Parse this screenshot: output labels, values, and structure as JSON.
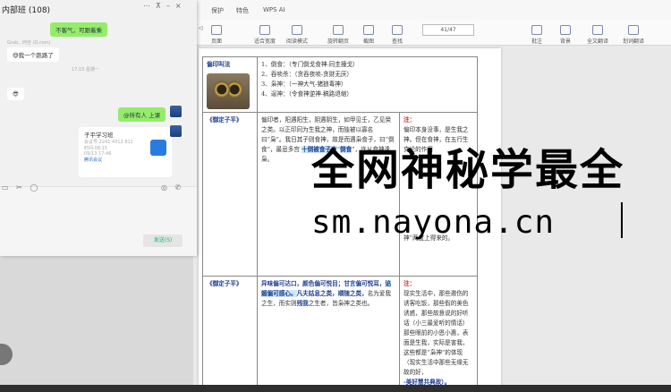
{
  "chat": {
    "title": "内部班 (108)",
    "bubbles": {
      "me1": "不客气，可跟着乘",
      "other1": "我一个跑路了",
      "other_sender": "Grab...何佳 (Q.com)",
      "me2": "@所有人  上课"
    },
    "time1": "17:15 星期一",
    "card": {
      "title": "子平学习班",
      "line1": "会议号:2241 4312 811",
      "line2": "时间:08:15",
      "line3": "09/13 17:46",
      "source": "腾讯会议"
    },
    "send_label": "发送(S)",
    "colors": {
      "me_bubble": "#95ec69"
    }
  },
  "doc": {
    "menu": [
      "保护",
      "特色",
      "WPS AI"
    ],
    "page_indicator": "41/47",
    "toolbar_items": [
      "◁",
      "页面",
      "适合宽度",
      "阅读模式",
      "旋转翻页",
      "截图",
      "查找",
      "批注",
      "背景",
      "全文翻译",
      "划词翻译"
    ],
    "table": {
      "row1": {
        "label": "偏印叫法",
        "items": [
          "1、倒食：（专门倒戈食神-同圭撞戈）",
          "2、吞啖杀：（贪吞夜啖-贪财无厌）",
          "3、枭神：（一神大气-猪狼毒神）",
          "4、逞神：（令食神逆神-稿路退缩）"
        ]
      },
      "row2": {
        "label": "《御定子平》",
        "body": "偏印者，阳遇阳生，阴遇阴生，如甲见壬，乙见癸之类。以正印同为生我之神，而独被以寡名曰“枭”。我日其子则食神，故是而遇枭食子，曰“倒食”，最忌多宫",
        "hl1": "十倒被食子之",
        "hl2": "倒食",
        "tail": "”，许从食神逢枭。",
        "note_label": "注：",
        "note": "偏印本身没事，是生我之神。但在食神，在五行生克论的作用",
        "note_tail": "神”两度上得来的。"
      },
      "row3": {
        "label": "《御定子平》",
        "body1": "异味偏可达口，",
        "body2": "颜色偏可悦目；",
        "body3": "甘言偏可悦耳，",
        "body4": "谄媚偏可感心。",
        "body5": "凡夫姑息之类，",
        "body6": "顺随之类，",
        "body7": "名为爱我之生，而实则",
        "body8": "残我",
        "body9": "之生者，皆枭神之类也。",
        "note_label": "注：",
        "note": "现实生活中，那些邀伤的诱客吃饭，那些假的美色诱惑，那些故意说的好听话（小三最爱听的情话）那些眼前的小恩小惠，表面是生我，实际是害我，这些都是“枭神”的体现（现实生活中那些无缘无故的好，",
        "note_end": "-美好慧共典故）。"
      }
    }
  },
  "watermark": {
    "line1": "全网神秘学最全",
    "line2": "sm.nayona.cn"
  }
}
